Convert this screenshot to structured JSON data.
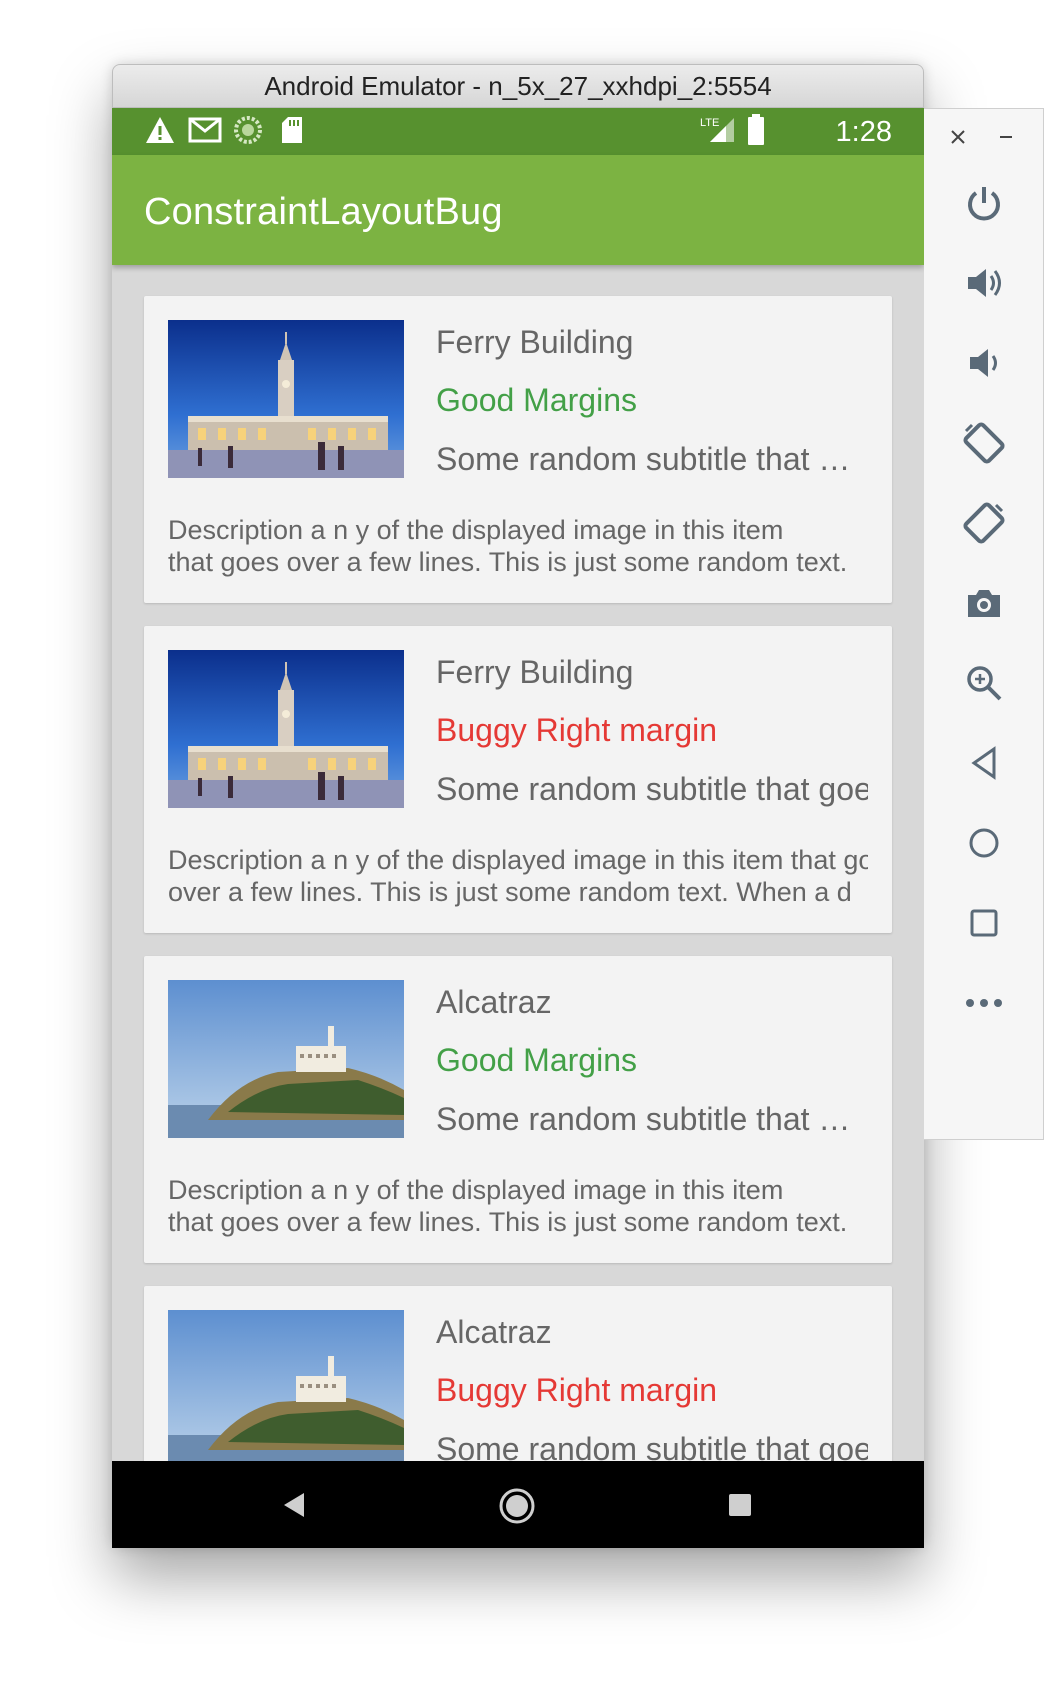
{
  "window": {
    "title": "Android Emulator - n_5x_27_xxhdpi_2:5554"
  },
  "status_bar": {
    "time": "1:28",
    "network": "LTE",
    "icons": [
      "warning-icon",
      "gmail-icon",
      "sync-icon",
      "sd-card-icon",
      "signal-icon",
      "battery-icon"
    ]
  },
  "app_bar": {
    "title": "ConstraintLayoutBug"
  },
  "colors": {
    "status_bar": "#57912f",
    "app_bar": "#7cb342",
    "good_text": "#43a047",
    "buggy_text": "#e53935",
    "body_text": "#666666",
    "card_bg": "#f3f3f3",
    "list_bg": "#d8d8d8"
  },
  "cards": [
    {
      "image": "ferry-building-image",
      "title": "Ferry Building",
      "margin_label": "Good Margins",
      "subtitle": "Some random subtitle that goes",
      "description_line1": "Description a n y of the displayed image in this item",
      "description_line2": "that goes over a few lines. This is just some random text."
    },
    {
      "image": "ferry-building-image",
      "title": "Ferry Building",
      "margin_label": "Buggy Right margin",
      "subtitle": "Some random subtitle that goes",
      "description_line1": "Description a n y of the displayed image in this item that goes",
      "description_line2": "over a few lines. This is just some random text. When a d"
    },
    {
      "image": "alcatraz-image",
      "title": "Alcatraz",
      "margin_label": "Good Margins",
      "subtitle": "Some random subtitle that goes",
      "description_line1": "Description a n y of the displayed image in this item",
      "description_line2": "that goes over a few lines. This is just some random text."
    },
    {
      "image": "alcatraz-image",
      "title": "Alcatraz",
      "margin_label": "Buggy Right margin",
      "subtitle": "Some random subtitle that goes"
    }
  ],
  "nav_bar": {
    "buttons": [
      "back",
      "home",
      "recents"
    ]
  },
  "side_panel": {
    "window_controls": [
      "close",
      "minimize"
    ],
    "buttons": [
      "power",
      "volume-up",
      "volume-down",
      "rotate-left",
      "rotate-right",
      "screenshot",
      "zoom",
      "back",
      "home",
      "overview",
      "more"
    ]
  }
}
